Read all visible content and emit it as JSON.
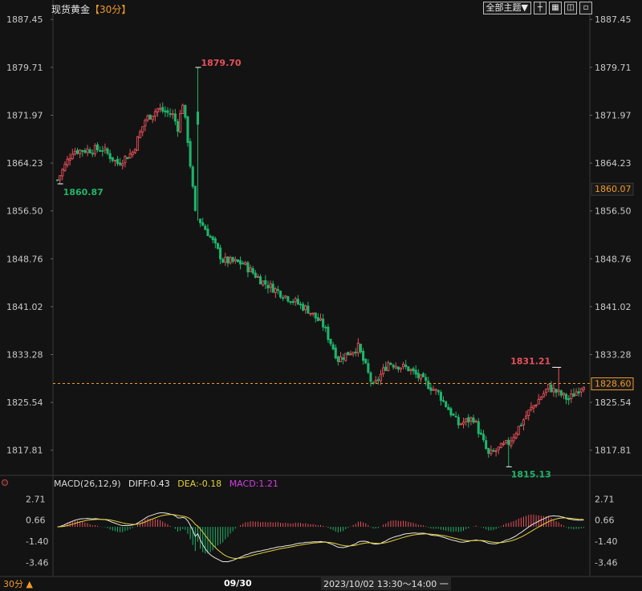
{
  "header": {
    "symbol": "现货黄金",
    "timeframe_label": "【30分】",
    "theme_button": "全部主题▼",
    "icons": [
      "crosshair-icon",
      "grid-icon",
      "restore-icon",
      "close-icon"
    ]
  },
  "chart_data": [
    {
      "type": "candlestick",
      "ylim": [
        1814,
        1888
      ],
      "yticks": [
        "1887.45",
        "1879.71",
        "1871.97",
        "1864.23",
        "1856.50",
        "1848.76",
        "1841.02",
        "1833.28",
        "1825.54",
        "1817.81"
      ],
      "high_label": "1879.70",
      "low_label_left": "1860.87",
      "recent_high_label": "1831.21",
      "recent_low_label": "1815.13",
      "last_price": "1828.60",
      "marker_price": "1860.07",
      "current_price_line": 1828.6,
      "colors": {
        "up": "#e8505b",
        "down": "#1fb56b",
        "line": "#f29a28"
      }
    },
    {
      "type": "macd",
      "ylim": [
        -4.6,
        3.6
      ],
      "yticks": [
        "2.71",
        "0.66",
        "-1.40",
        "-3.46"
      ],
      "colors": {
        "diff": "#e6e6e6",
        "dea": "#e3d13a",
        "hist_up": "#e8505b",
        "hist_down": "#1fb56b"
      }
    }
  ],
  "macd": {
    "label": "MACD(26,12,9)",
    "diff": "DIFF:0.43",
    "dea": "DEA:-0.18",
    "macd": "MACD:1.21"
  },
  "footer": {
    "timeframe": "30分 ▲",
    "date": "09/30",
    "range": "2023/10/02 13:30～14:00 一"
  }
}
